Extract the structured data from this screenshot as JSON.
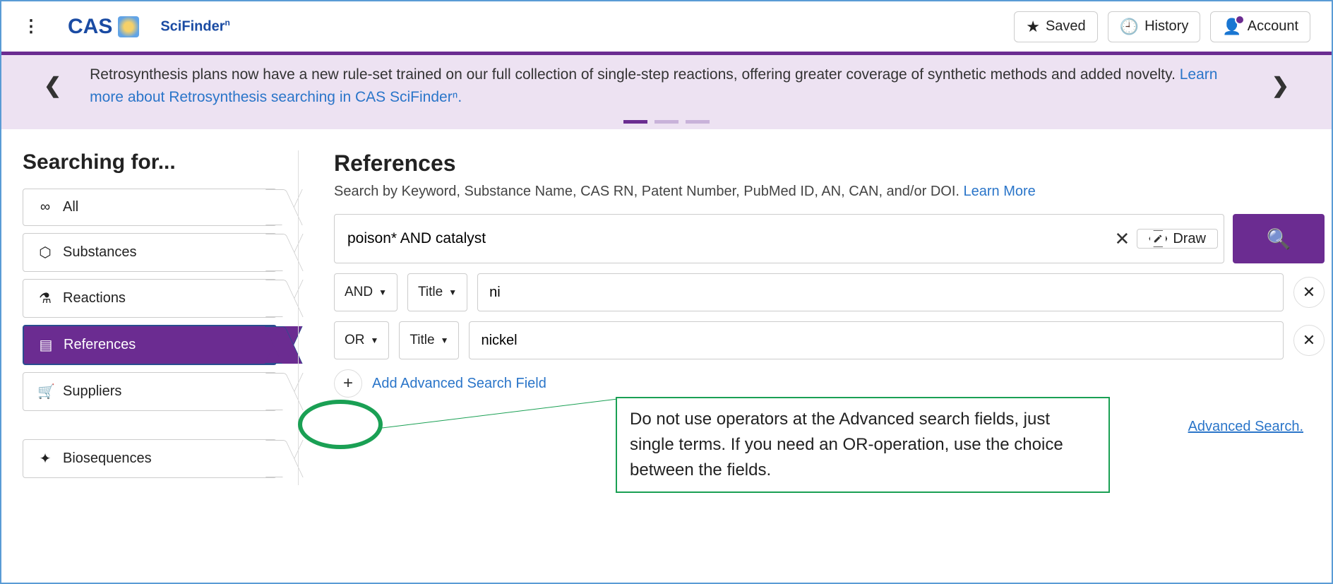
{
  "header": {
    "brand1": "CAS",
    "brand2": "SciFinder",
    "brand2_sup": "n",
    "saved": "Saved",
    "history": "History",
    "account": "Account"
  },
  "banner": {
    "text": "Retrosynthesis plans now have a new rule-set trained on our full collection of single-step reactions, offering greater coverage of synthetic methods and added novelty. ",
    "link_text": "Learn more about Retrosynthesis searching in CAS SciFinderⁿ."
  },
  "sidebar": {
    "title": "Searching for...",
    "items": [
      {
        "label": "All",
        "icon": "∞"
      },
      {
        "label": "Substances",
        "icon": "⬡"
      },
      {
        "label": "Reactions",
        "icon": "⚗"
      },
      {
        "label": "References",
        "icon": "▤"
      },
      {
        "label": "Suppliers",
        "icon": "🛒"
      }
    ],
    "bio": {
      "label": "Biosequences",
      "icon": "✦"
    }
  },
  "content": {
    "title": "References",
    "subtitle": "Search by Keyword, Substance Name, CAS RN, Patent Number, PubMed ID, AN, CAN, and/or DOI. ",
    "learn_more": "Learn More",
    "main_query": "poison* AND catalyst",
    "draw_label": "Draw",
    "rows": [
      {
        "op": "AND",
        "field": "Title",
        "value": "ni"
      },
      {
        "op": "OR",
        "field": "Title",
        "value": "nickel"
      }
    ],
    "add_field": "Add Advanced Search Field",
    "tip": "Advanced Search."
  },
  "annotation": "Do not use operators at the Advanced search fields, just single terms. If you need an OR-operation, use the choice between the fields."
}
